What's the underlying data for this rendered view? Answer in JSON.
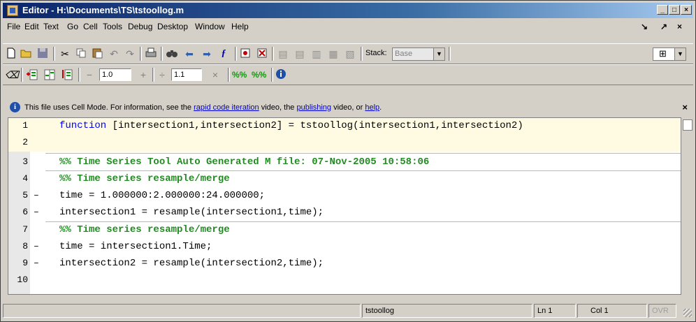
{
  "window": {
    "title": "Editor - H:\\Documents\\TS\\tstoollog.m"
  },
  "title_buttons": {
    "minimize": "_",
    "maximize": "□",
    "close": "×"
  },
  "menu": [
    "File",
    "Edit",
    "Text",
    "Go",
    "Cell",
    "Tools",
    "Debug",
    "Desktop",
    "Window",
    "Help"
  ],
  "menu_right": {
    "dock": "↘",
    "undock": "↗",
    "close": "×"
  },
  "toolbar1": {
    "stack_label": "Stack:",
    "stack_value": "Base",
    "icons": [
      "new-file-icon",
      "open-file-icon",
      "save-icon",
      "cut-icon",
      "copy-icon",
      "paste-icon",
      "undo-icon",
      "redo-icon",
      "print-icon",
      "find-icon",
      "back-icon",
      "forward-icon",
      "function-icon",
      "set-breakpoint-icon",
      "clear-breakpoint-icon",
      "step-icon",
      "step-in-icon",
      "step-out-icon",
      "continue-icon",
      "exit-debug-icon",
      "layout-grid-icon"
    ]
  },
  "toolbar2": {
    "minus": "−",
    "value1": "1.0",
    "plus": "+",
    "divide": "÷",
    "value2": "1.1",
    "times": "×"
  },
  "infobar": {
    "prefix": "This file uses Cell Mode. For information, see the ",
    "link1": "rapid code iteration",
    "mid1": " video, the ",
    "link2": "publishing",
    "mid2": " video, or ",
    "link3": "help",
    "suffix": "."
  },
  "code_lines": [
    {
      "num": "1",
      "bp": "",
      "text": "function [intersection1,intersection2] = tstoollog(intersection1,intersection2)"
    },
    {
      "num": "2",
      "bp": "",
      "text": ""
    },
    {
      "num": "3",
      "bp": "",
      "text": "%% Time Series Tool Auto Generated M file: 07-Nov-2005 10:58:06"
    },
    {
      "num": "4",
      "bp": "",
      "text": "%% Time series resample/merge"
    },
    {
      "num": "5",
      "bp": "–",
      "text": "time = 1.000000:2.000000:24.000000;"
    },
    {
      "num": "6",
      "bp": "–",
      "text": "intersection1 = resample(intersection1,time);"
    },
    {
      "num": "7",
      "bp": "",
      "text": "%% Time series resample/merge"
    },
    {
      "num": "8",
      "bp": "–",
      "text": "time = intersection1.Time;"
    },
    {
      "num": "9",
      "bp": "–",
      "text": "intersection2 = resample(intersection2,time);"
    },
    {
      "num": "10",
      "bp": "",
      "text": ""
    }
  ],
  "function_keyword": "function",
  "function_rest": " [intersection1,intersection2] = tstoollog(intersection1,intersection2)",
  "status": {
    "file": "tstoollog",
    "ln": "Ln  1",
    "col": "Col  1",
    "ovr": "OVR"
  }
}
